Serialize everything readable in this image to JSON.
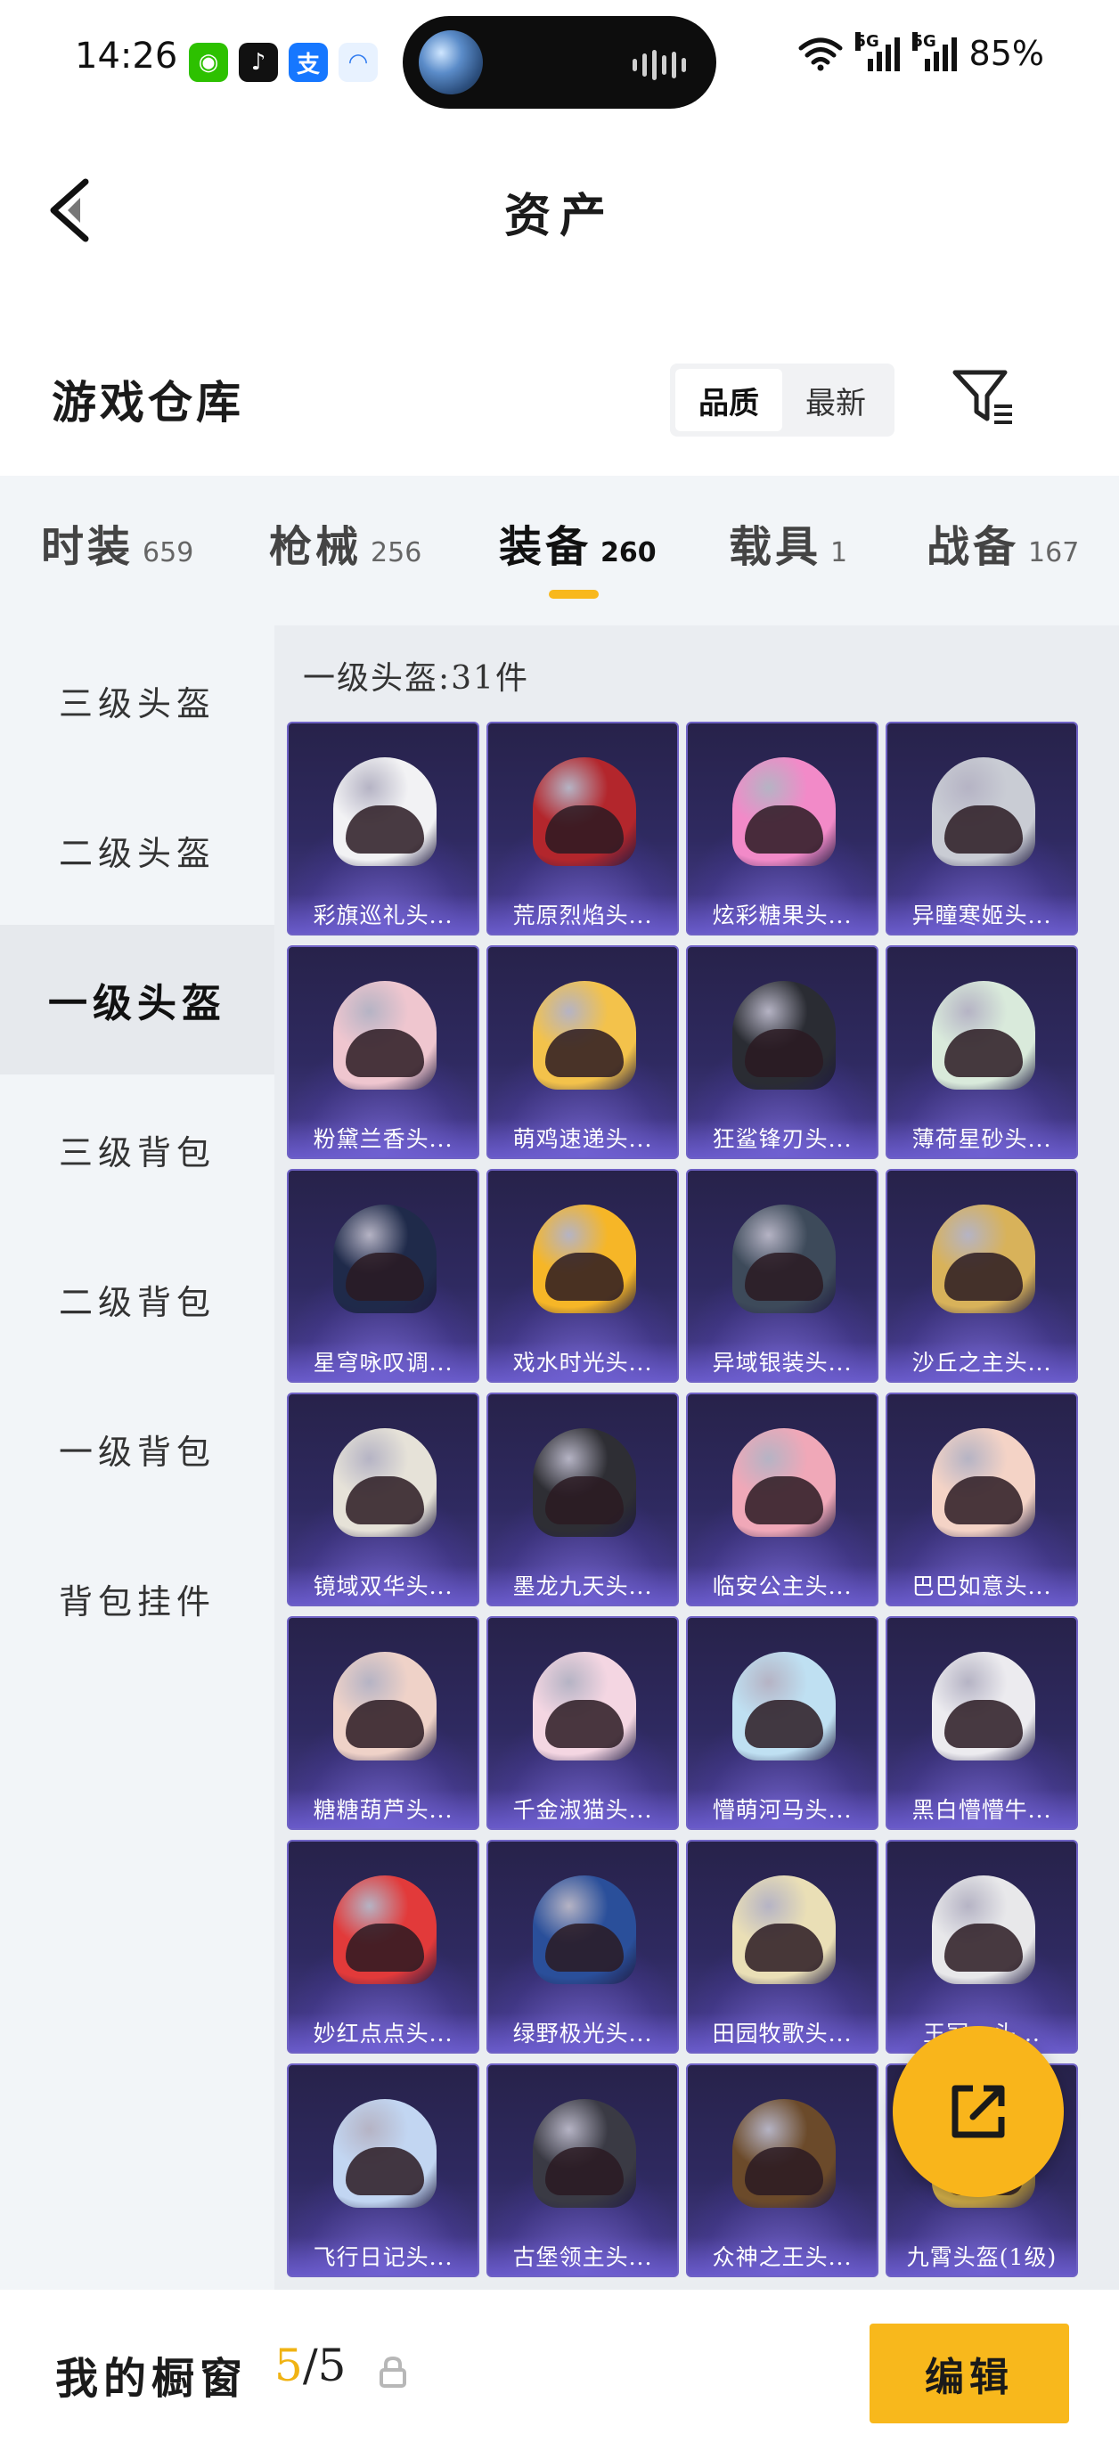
{
  "status_bar": {
    "time": "14:26",
    "apps": [
      {
        "icon": "wechat-icon",
        "color": "#2dc100",
        "glyph": "◉"
      },
      {
        "icon": "tiktok-icon",
        "color": "#111111",
        "glyph": "♪"
      },
      {
        "icon": "alipay-icon",
        "color": "#1677ff",
        "glyph": "支"
      },
      {
        "icon": "cloud-app-icon",
        "color": "#e8f2ff",
        "glyph": "◠"
      }
    ],
    "network_1": "5G",
    "network_2": "5G",
    "battery": "85%"
  },
  "header": {
    "title": "资产",
    "back_icon": "chevron-left-icon"
  },
  "warehouse": {
    "title": "游戏仓库",
    "sort_options": [
      "品质",
      "最新"
    ],
    "sort_selected": "品质",
    "filter_icon": "filter-list-icon"
  },
  "tabs": [
    {
      "label": "时装",
      "count": "659",
      "active": false
    },
    {
      "label": "枪械",
      "count": "256",
      "active": false
    },
    {
      "label": "装备",
      "count": "260",
      "active": true
    },
    {
      "label": "载具",
      "count": "1",
      "active": false
    },
    {
      "label": "战备",
      "count": "167",
      "active": false
    }
  ],
  "accent_color": "#f8b81c",
  "side_nav": [
    {
      "label": "三级头盔",
      "active": false
    },
    {
      "label": "二级头盔",
      "active": false
    },
    {
      "label": "一级头盔",
      "active": true
    },
    {
      "label": "三级背包",
      "active": false
    },
    {
      "label": "二级背包",
      "active": false
    },
    {
      "label": "一级背包",
      "active": false
    },
    {
      "label": "背包挂件",
      "active": false
    }
  ],
  "section": {
    "title": "一级头盔:31件"
  },
  "items": [
    {
      "name": "彩旗巡礼头...",
      "color": "#f2f2f4"
    },
    {
      "name": "荒原烈焰头...",
      "color": "#b3262c"
    },
    {
      "name": "炫彩糖果头...",
      "color": "#f28ac8"
    },
    {
      "name": "异瞳寒姬头...",
      "color": "#c9ccd4"
    },
    {
      "name": "粉黛兰香头...",
      "color": "#efc6cf"
    },
    {
      "name": "萌鸡速递头...",
      "color": "#f3c24b"
    },
    {
      "name": "狂鲨锋刃头...",
      "color": "#2a2c33"
    },
    {
      "name": "薄荷星砂头...",
      "color": "#d9eadb"
    },
    {
      "name": "星穹咏叹调...",
      "color": "#1f2a4a"
    },
    {
      "name": "戏水时光头...",
      "color": "#f6b627"
    },
    {
      "name": "异域银装头...",
      "color": "#3d4a5a"
    },
    {
      "name": "沙丘之主头...",
      "color": "#d8b25a"
    },
    {
      "name": "镜域双华头...",
      "color": "#e6e2d8"
    },
    {
      "name": "墨龙九天头...",
      "color": "#2e2e34"
    },
    {
      "name": "临安公主头...",
      "color": "#f0a8b8"
    },
    {
      "name": "巴巴如意头...",
      "color": "#f4d3c6"
    },
    {
      "name": "糖糖葫芦头...",
      "color": "#efd2c8"
    },
    {
      "name": "千金淑猫头...",
      "color": "#f4d6e2"
    },
    {
      "name": "懵萌河马头...",
      "color": "#bfe0f2"
    },
    {
      "name": "黑白懵懵牛...",
      "color": "#ecebef"
    },
    {
      "name": "妙红点点头...",
      "color": "#e23a3a"
    },
    {
      "name": "绿野极光头...",
      "color": "#2a4f9a"
    },
    {
      "name": "田园牧歌头...",
      "color": "#eadfb6"
    },
    {
      "name": "王冠...头...",
      "color": "#e8e8ea"
    },
    {
      "name": "飞行日记头...",
      "color": "#c2d6f2"
    },
    {
      "name": "古堡领主头...",
      "color": "#3a3a44"
    },
    {
      "name": "众神之王头...",
      "color": "#6b4a2a"
    },
    {
      "name": "九霄头盔(1级)",
      "color": "#d9b44a"
    }
  ],
  "fab": {
    "icon": "share-external-icon"
  },
  "bottom_bar": {
    "label": "我的橱窗",
    "current": "5",
    "separator": "/",
    "total": "5",
    "lock_icon": "lock-icon",
    "edit_label": "编辑"
  }
}
